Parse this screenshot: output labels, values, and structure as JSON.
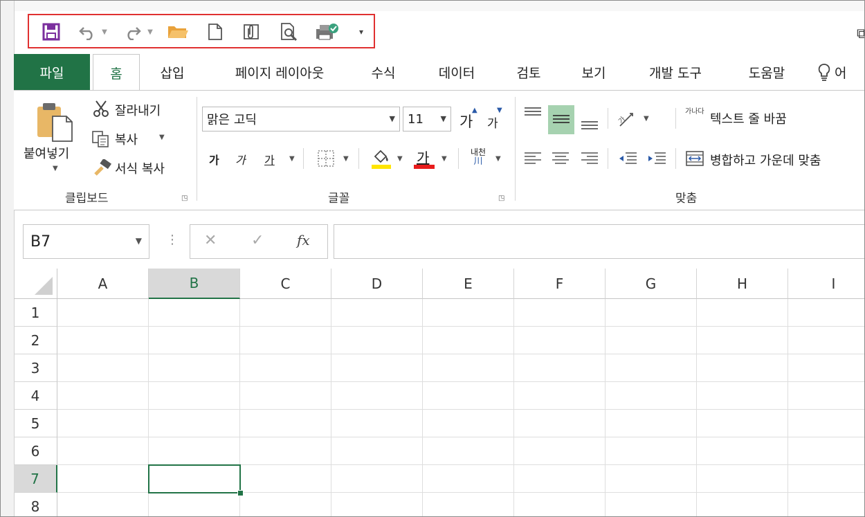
{
  "quick_access": {
    "icons": [
      "save-icon",
      "undo-icon",
      "redo-icon",
      "open-folder-icon",
      "new-file-icon",
      "attach-icon",
      "print-preview-icon",
      "publish-icon",
      "customize-dropdown-icon"
    ],
    "colors": {
      "save": "#7b2f9e",
      "folder": "#e9a23b",
      "highlight": "#e03030"
    }
  },
  "tabs": [
    "파일",
    "홈",
    "삽입",
    "페이지 레이아웃",
    "수식",
    "데이터",
    "검토",
    "보기",
    "개발 도구",
    "도움말"
  ],
  "tell_me_partial": "어",
  "ribbon": {
    "clipboard": {
      "paste": "붙여넣기",
      "cut": "잘라내기",
      "copy": "복사",
      "format_painter": "서식 복사",
      "label": "클립보드"
    },
    "font": {
      "name": "맑은 고딕",
      "size": "11",
      "grow": "가",
      "shrink": "가",
      "bold": "가",
      "italic": "가",
      "underline": "가",
      "font_color_glyph": "가",
      "phonetic": "내천",
      "label": "글꼴"
    },
    "alignment": {
      "wrap_text": "텍스트 줄 바꿈",
      "wrap_glyph": "가나다",
      "merge_center": "병합하고 가운데 맞춤",
      "label": "맞춤"
    }
  },
  "formula_bar": {
    "name_box": "B7",
    "cancel": "✕",
    "enter": "✓",
    "fx": "fx",
    "value": ""
  },
  "grid": {
    "columns": [
      "A",
      "B",
      "C",
      "D",
      "E",
      "F",
      "G",
      "H",
      "I"
    ],
    "rows": [
      "1",
      "2",
      "3",
      "4",
      "5",
      "6",
      "7",
      "8"
    ],
    "selected_column": "B",
    "selected_row": "7",
    "accent": "#217346"
  }
}
